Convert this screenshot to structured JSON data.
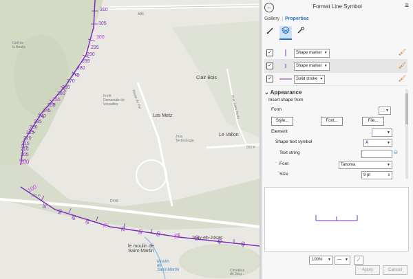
{
  "map": {
    "place_labels": [
      {
        "id": "golf",
        "text": "Golf de\nla Boulie"
      },
      {
        "id": "foret",
        "text": "Forêt\nDomaniale de\nVersailles"
      },
      {
        "id": "clair-bois",
        "text": "Clair Bois"
      },
      {
        "id": "les-metz",
        "text": "Les Metz"
      },
      {
        "id": "jouy-tech",
        "text": "Jouy\nTechnologie"
      },
      {
        "id": "le-vallon",
        "text": "Le Vallon"
      },
      {
        "id": "moulin",
        "text": "le moulin de\nSaint-Martin"
      },
      {
        "id": "jouy",
        "text": "Jouy-en-Josas"
      },
      {
        "id": "moulin-blue",
        "text": "Moulin\nde\nSaint-Martin"
      },
      {
        "id": "cimetiere",
        "text": "Cimetière\nde Jouy..."
      }
    ],
    "road_labels": [
      {
        "id": "a86",
        "text": "A86"
      },
      {
        "id": "d446",
        "text": "D446"
      },
      {
        "id": "d53",
        "text": "D53 P"
      },
      {
        "id": "route",
        "text": "Route du Pal"
      },
      {
        "id": "rue",
        "text": "Rue Jules Ferry"
      }
    ],
    "measures_upper": [
      "310",
      "305",
      "300",
      "295",
      "290",
      "285",
      "280",
      "275",
      "270",
      "265",
      "260",
      "255",
      "250",
      "245",
      "240",
      "235",
      "230",
      "225",
      "220",
      "215",
      "210",
      "205",
      "200"
    ],
    "measures_lower": [
      "100",
      "95",
      "90",
      "85",
      "80",
      "75",
      "70",
      "65",
      "60",
      "55",
      "50",
      "45",
      "40"
    ],
    "measure_extra": "100 m",
    "colors": {
      "route": "#7b2fb8",
      "route_highlight": "#c040e0"
    }
  },
  "pane": {
    "title": "Format Line Symbol",
    "back_icon": "←",
    "menu_icon": "≡",
    "tabs": [
      {
        "label": "Gallery",
        "active": false
      },
      {
        "label": "Properties",
        "active": true
      }
    ],
    "tab_separator": "|",
    "subtab_icons": [
      "brush-icon",
      "layers-icon",
      "wrench-icon"
    ],
    "layers": [
      {
        "type": "Shape marker",
        "checked": true,
        "selected": false
      },
      {
        "type": "Shape marker",
        "checked": true,
        "selected": true
      },
      {
        "type": "Solid stroke",
        "checked": true,
        "selected": false
      }
    ],
    "appearance": {
      "title": "Appearance",
      "insert_from": "Insert shape from",
      "form_label": "Form",
      "style_button": "Style...",
      "font_button": "Font...",
      "file_button": "File...",
      "element_label": "Element",
      "shape_text_symbol_label": "Shape text symbol",
      "text_string_label": "Text string",
      "font_label": "Font",
      "font_value": "Tahoma",
      "size_label": "Size",
      "size_value": "9 pt"
    },
    "zoom_value": "100%",
    "apply_label": "Apply",
    "cancel_label": "Cancel"
  }
}
